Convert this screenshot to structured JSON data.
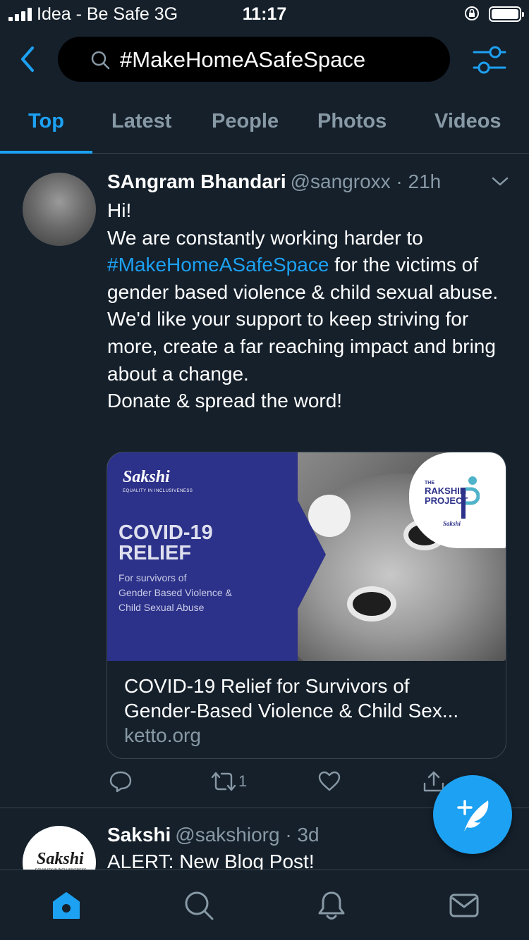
{
  "status_bar": {
    "carrier": "Idea - Be Safe  3G",
    "time": "11:17"
  },
  "search": {
    "query": "#MakeHomeASafeSpace"
  },
  "tabs": [
    {
      "label": "Top",
      "active": true
    },
    {
      "label": "Latest",
      "active": false
    },
    {
      "label": "People",
      "active": false
    },
    {
      "label": "Photos",
      "active": false
    },
    {
      "label": "Videos",
      "active": false
    }
  ],
  "tweet1": {
    "name": "SAngram Bhandari",
    "handle": "@sangroxx · 21h",
    "text_line1": "Hi!",
    "text_line2": "We are constantly working harder to",
    "hashtag": "#MakeHomeASafeSpace",
    "text_after_hashtag": " for the victims of gender based violence & child sexual abuse.",
    "text_para2": "We'd like your support to keep striving for more, create a far reaching impact and bring about a change.",
    "text_para3": "Donate & spread the word!",
    "card": {
      "logo": "Sakshi",
      "logo_sub": "EQUALITY IN INCLUSIVENESS",
      "image_title": "COVID-19\nRELIEF",
      "image_subtitle": "For survivors of\nGender Based Violence &\nChild Sexual Abuse",
      "badge_the": "THE",
      "badge_text": "RAKSHIN\nPROJECT",
      "badge_sub": "Sakshi",
      "title_line1": "COVID-19 Relief for Survivors of",
      "title_line2": "Gender-Based Violence & Child Sex...",
      "domain": "ketto.org"
    },
    "retweet_count": "1"
  },
  "tweet2": {
    "name": "Sakshi",
    "handle": "@sakshiorg · 3d",
    "text": "ALERT: New Blog Post!",
    "avatar_logo": "Sakshi",
    "avatar_logo_sub": "EQUALITY IN INCLUSIVENESS"
  },
  "colors": {
    "background": "#15202b",
    "accent": "#1da1f2",
    "secondary_text": "#8899a6",
    "divider": "#38444d"
  },
  "icons": [
    "back-arrow-icon",
    "search-icon",
    "filter-icon",
    "chevron-down-icon",
    "reply-icon",
    "retweet-icon",
    "like-icon",
    "share-icon",
    "compose-icon",
    "home-icon",
    "explore-icon",
    "notifications-icon",
    "messages-icon"
  ]
}
